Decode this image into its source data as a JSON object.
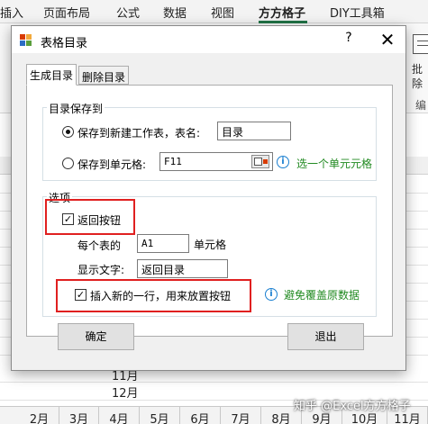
{
  "excel": {
    "ribbon_tabs": [
      {
        "label": "插入",
        "active": false
      },
      {
        "label": "页面布局",
        "active": false
      },
      {
        "label": "公式",
        "active": false
      },
      {
        "label": "数据",
        "active": false
      },
      {
        "label": "视图",
        "active": false
      },
      {
        "label": "方方格子",
        "active": true
      },
      {
        "label": "DIY工具箱",
        "active": false
      }
    ],
    "ribbon_side_label_1": "批",
    "ribbon_side_label_2": "除",
    "ribbon_group_label": "编",
    "sheet_cells": [
      "11月",
      "12月"
    ],
    "sheet_tabs": [
      "2月",
      "3月",
      "4月",
      "5月",
      "6月",
      "7月",
      "8月",
      "9月",
      "10月",
      "11月"
    ],
    "watermark": "知乎 @Excel方方格子"
  },
  "dialog": {
    "title": "表格目录",
    "help_label": "?",
    "close_label": "✕",
    "tabs": [
      {
        "label": "生成目录",
        "active": true
      },
      {
        "label": "删除目录",
        "active": false
      }
    ],
    "save_group": {
      "title": "目录保存到",
      "option_new_sheet_label": "保存到新建工作表，表名:",
      "new_sheet_name": "目录",
      "option_cell_label": "保存到单元格:",
      "cell_value": "F11",
      "select_cell_hint": "选一个单元元格"
    },
    "options_group": {
      "title": "选项",
      "back_button_label": "返回按钮",
      "back_button_checked": true,
      "each_sheet_label": "每个表的",
      "each_sheet_cell": "A1",
      "cell_suffix_label": "单元格",
      "display_text_label": "显示文字:",
      "display_text_value": "返回目录",
      "insert_row_label": "插入新的一行，用来放置按钮",
      "insert_row_checked": true,
      "avoid_overwrite_hint": "避免覆盖原数据"
    },
    "ok_label": "确定",
    "exit_label": "退出"
  },
  "colors": {
    "excel_green": "#217346",
    "highlight_red": "#e02020",
    "hint_green": "#218a21",
    "info_blue": "#1a7fd0"
  },
  "icons": {
    "app_icon": "table-app-icon",
    "cell_picker": "cell-picker-icon",
    "info": "info-icon"
  }
}
